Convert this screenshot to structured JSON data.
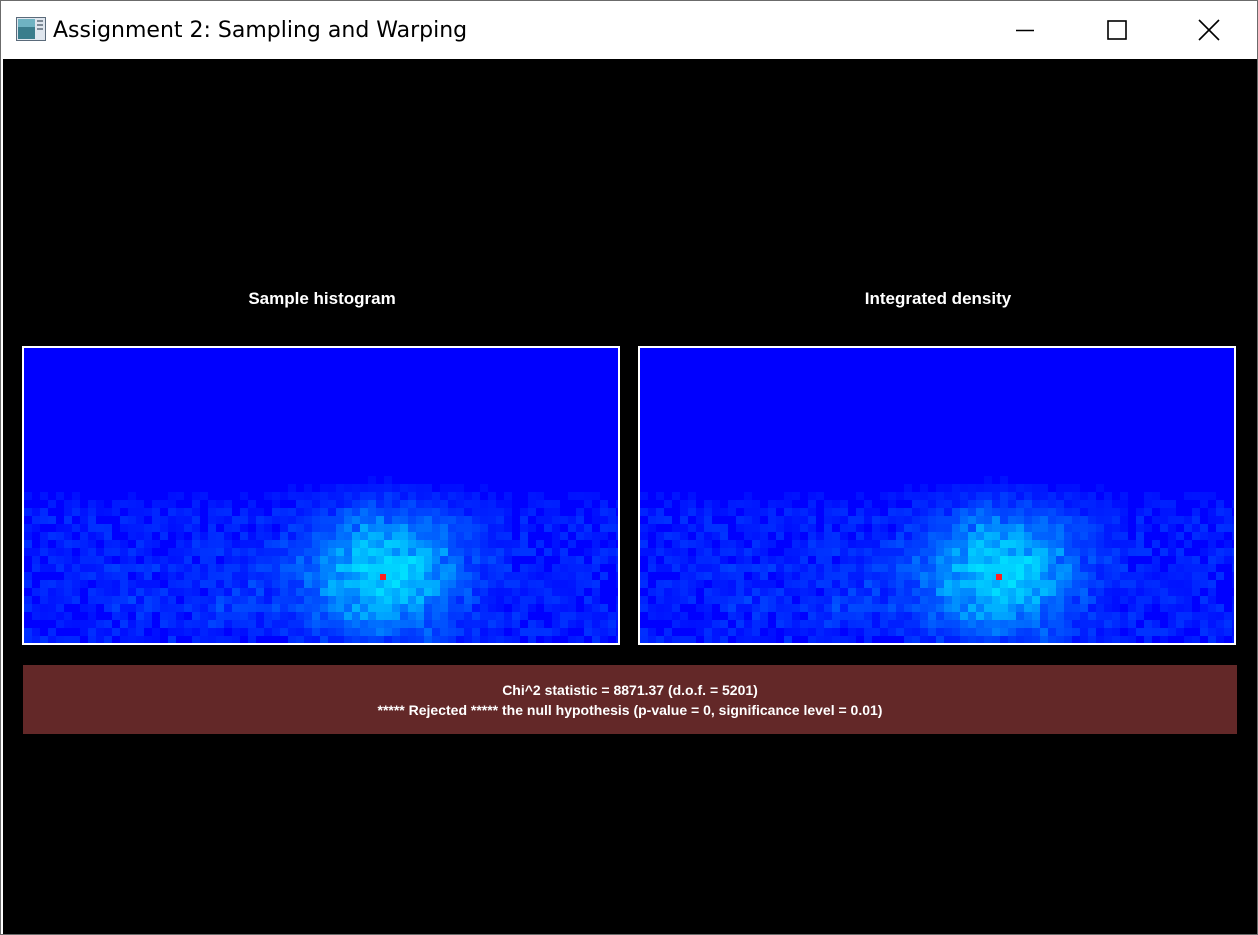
{
  "window": {
    "title": "Assignment 2: Sampling and Warping",
    "icon": "app-window-icon",
    "controls": {
      "minimize_icon": "minimize-icon",
      "maximize_icon": "maximize-icon",
      "close_icon": "close-icon"
    }
  },
  "panels": {
    "left_title": "Sample histogram",
    "right_title": "Integrated density",
    "colormap": [
      "#0000ff",
      "#0050ff",
      "#00a8ff",
      "#00ffff",
      "#ff0000"
    ]
  },
  "result": {
    "line1": "Chi^2 statistic = 8871.37 (d.o.f. = 5201)",
    "line2": "***** Rejected ***** the null hypothesis (p-value = 0, significance level = 0.01)",
    "background": "#632828"
  }
}
